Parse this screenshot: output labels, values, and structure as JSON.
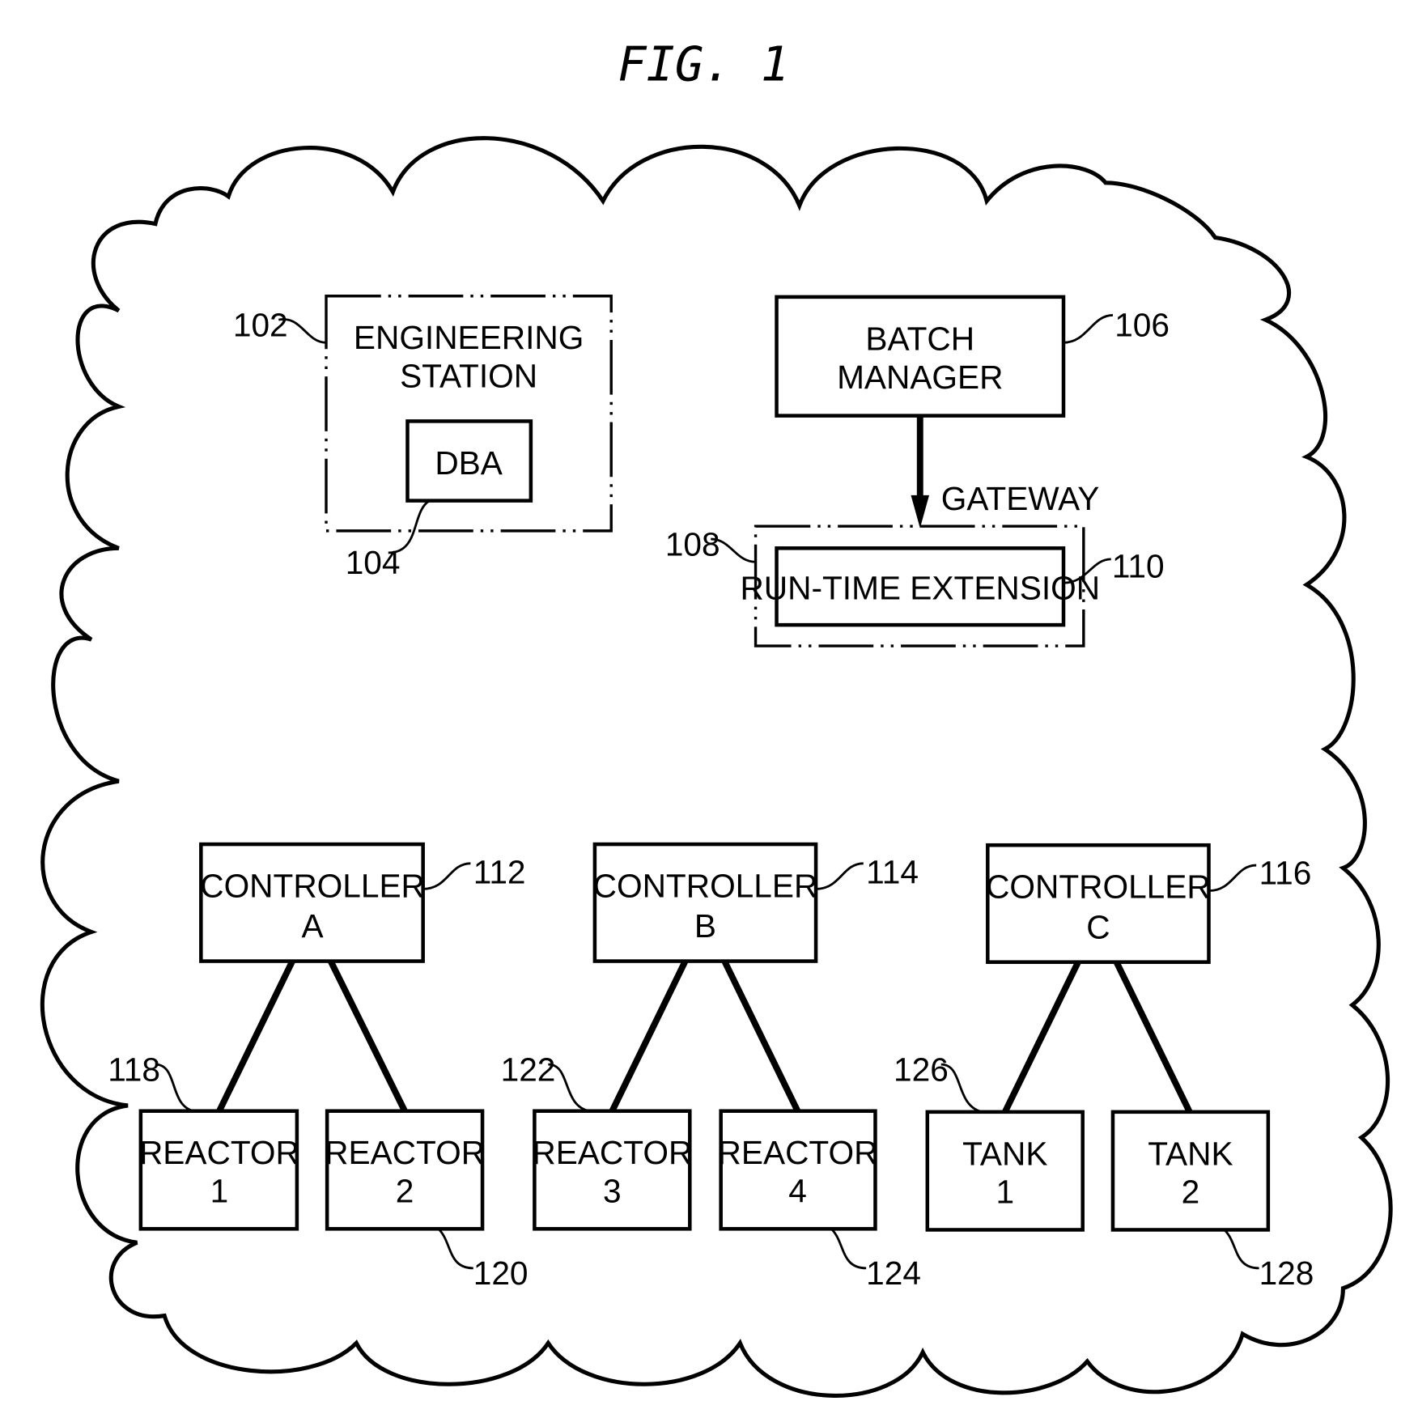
{
  "figure": {
    "title": "FIG. 1"
  },
  "nodes": {
    "engineering_station": {
      "line1": "ENGINEERING",
      "line2": "STATION",
      "ref": "102"
    },
    "dba": {
      "label": "DBA",
      "ref": "104"
    },
    "batch_manager": {
      "line1": "BATCH",
      "line2": "MANAGER",
      "ref": "106"
    },
    "gateway": {
      "label": "GATEWAY",
      "ref": "108"
    },
    "runtime_extension": {
      "label": "RUN-TIME EXTENSION",
      "ref": "110"
    },
    "controller_a": {
      "line1": "CONTROLLER",
      "line2": "A",
      "ref": "112"
    },
    "controller_b": {
      "line1": "CONTROLLER",
      "line2": "B",
      "ref": "114"
    },
    "controller_c": {
      "line1": "CONTROLLER",
      "line2": "C",
      "ref": "116"
    },
    "reactor_1": {
      "line1": "REACTOR",
      "line2": "1",
      "ref": "118"
    },
    "reactor_2": {
      "line1": "REACTOR",
      "line2": "2",
      "ref": "120"
    },
    "reactor_3": {
      "line1": "REACTOR",
      "line2": "3",
      "ref": "122"
    },
    "reactor_4": {
      "line1": "REACTOR",
      "line2": "4",
      "ref": "124"
    },
    "tank_1": {
      "line1": "TANK",
      "line2": "1",
      "ref": "126"
    },
    "tank_2": {
      "line1": "TANK",
      "line2": "2",
      "ref": "128"
    }
  },
  "edges": [
    {
      "from": "batch_manager",
      "to": "gateway",
      "type": "arrow"
    },
    {
      "from": "controller_a",
      "to": "reactor_1",
      "type": "line"
    },
    {
      "from": "controller_a",
      "to": "reactor_2",
      "type": "line"
    },
    {
      "from": "controller_b",
      "to": "reactor_3",
      "type": "line"
    },
    {
      "from": "controller_b",
      "to": "reactor_4",
      "type": "line"
    },
    {
      "from": "controller_c",
      "to": "tank_1",
      "type": "line"
    },
    {
      "from": "controller_c",
      "to": "tank_2",
      "type": "line"
    }
  ]
}
